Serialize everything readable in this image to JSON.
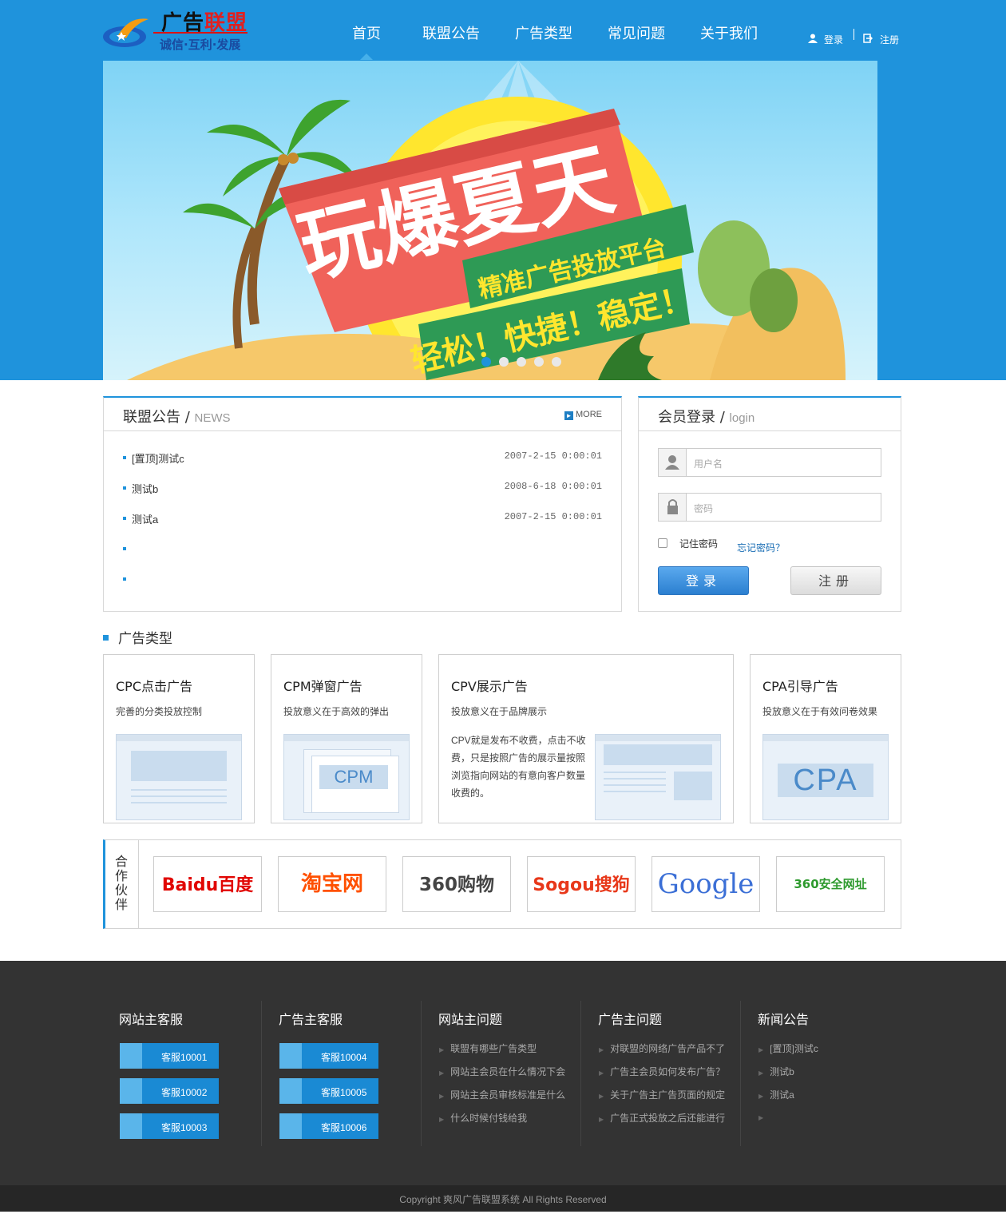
{
  "brand": {
    "name_black": "广告",
    "name_red": "联盟",
    "slogan": "诚信·互利·发展"
  },
  "nav": {
    "items": [
      "首页",
      "联盟公告",
      "广告类型",
      "常见问题",
      "关于我们"
    ],
    "active": "首页"
  },
  "userlinks": {
    "login": "登录",
    "register": "注册"
  },
  "banner": {
    "headline": "玩爆夏天",
    "sub1": "精准广告投放平台",
    "sub2": "轻松！快捷！稳定！",
    "dots": 5
  },
  "news": {
    "title": "联盟公告",
    "sub": "NEWS",
    "more": "MORE",
    "items": [
      {
        "title": "[置顶]测试c",
        "date": "2007-2-15 0:00:01"
      },
      {
        "title": "测试b",
        "date": "2008-6-18 0:00:01"
      },
      {
        "title": "测试a",
        "date": "2007-2-15 0:00:01"
      },
      {
        "title": "",
        "date": ""
      },
      {
        "title": "",
        "date": ""
      }
    ]
  },
  "login": {
    "title": "会员登录",
    "sub": "login",
    "username_ph": "用户名",
    "password_ph": "密码",
    "remember": "记住密码",
    "forgot": "忘记密码？",
    "login_btn": "登录",
    "register_btn": "注册"
  },
  "adtypes": {
    "title": "广告类型",
    "cards": [
      {
        "name": "CPC点击广告",
        "desc": "完善的分类投放控制"
      },
      {
        "name": "CPM弹窗广告",
        "desc": "投放意义在于高效的弹出",
        "badge": "CPM"
      },
      {
        "name": "CPV展示广告",
        "desc": "投放意义在于品牌展示",
        "detail": "CPV就是发布不收费，点击不收费，只是按照广告的展示量按照浏览指向网站的有意向客户数量收费的。"
      },
      {
        "name": "CPA引导广告",
        "desc": "投放意义在于有效问卷效果",
        "badge": "CPA"
      }
    ]
  },
  "partners": {
    "label": "合作伙伴",
    "logos": [
      "Baidu百度",
      "淘宝网",
      "360购物",
      "Sogou搜狗",
      "Google",
      "360安全网址"
    ]
  },
  "footer": {
    "cols": [
      {
        "title": "网站主客服",
        "kf": [
          "客服10001",
          "客服10002",
          "客服10003"
        ]
      },
      {
        "title": "广告主客服",
        "kf": [
          "客服10004",
          "客服10005",
          "客服10006"
        ]
      },
      {
        "title": "网站主问题",
        "links": [
          "联盟有哪些广告类型",
          "网站主会员在什么情况下会",
          "网站主会员审核标准是什么",
          "什么时候付钱给我"
        ]
      },
      {
        "title": "广告主问题",
        "links": [
          "对联盟的网络广告产品不了",
          "广告主会员如何发布广告？",
          "关于广告主广告页面的规定",
          "广告正式投放之后还能进行"
        ]
      },
      {
        "title": "新闻公告",
        "links": [
          "[置顶]测试c",
          "测试b",
          "测试a",
          ""
        ]
      }
    ],
    "copyright": "Copyright 爽风广告联盟系统 All Rights Reserved"
  },
  "colors": {
    "primary": "#1f93dc",
    "footer": "#333333"
  }
}
